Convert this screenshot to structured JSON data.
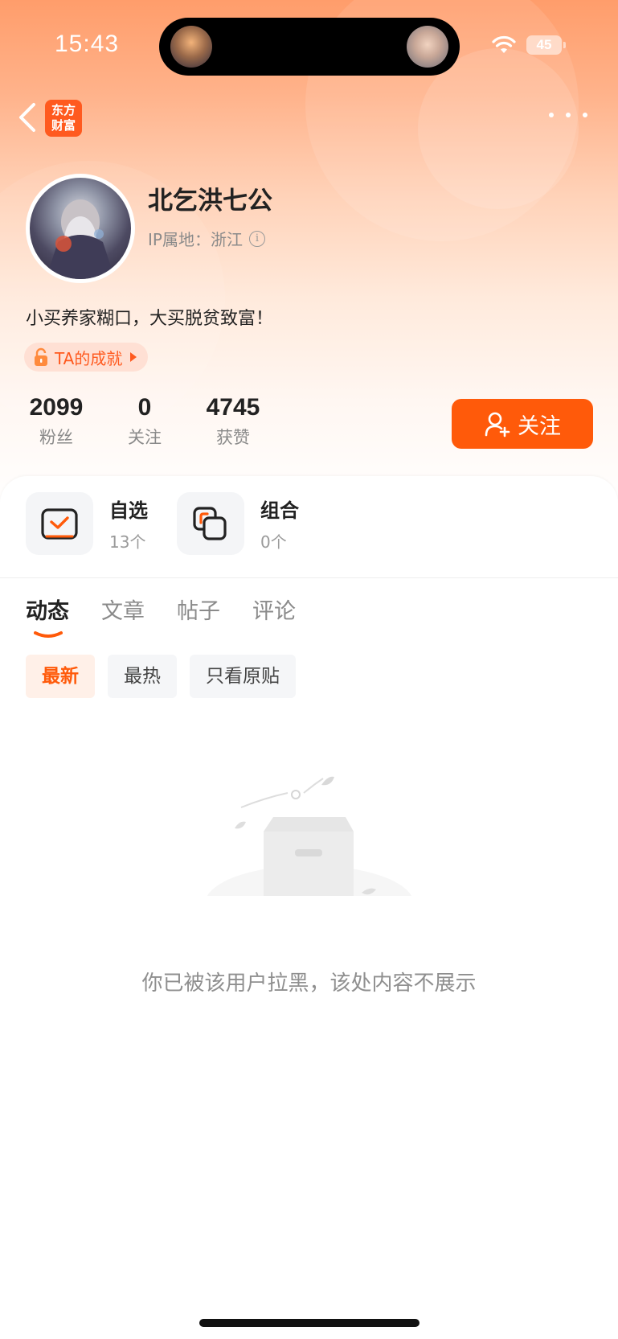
{
  "status_bar": {
    "time": "15:43",
    "battery": "45",
    "icons": [
      "wifi-icon",
      "battery-icon"
    ]
  },
  "nav": {
    "logo_line1": "东方",
    "logo_line2": "财富",
    "icons": [
      "back-arrow-icon",
      "more-dots-icon"
    ]
  },
  "profile": {
    "name": "北乞洪七公",
    "ip_label": "IP属地：",
    "ip_value": "浙江",
    "info_glyph": "i",
    "bio": "小买养家糊口，大买脱贫致富！",
    "achievement": "TA的成就"
  },
  "stats": [
    {
      "value": "2099",
      "label": "粉丝"
    },
    {
      "value": "0",
      "label": "关注"
    },
    {
      "value": "4745",
      "label": "获赞"
    }
  ],
  "follow_button": "关注",
  "tools": [
    {
      "title": "自选",
      "sub": "13个",
      "icon": "watchlist-check-icon"
    },
    {
      "title": "组合",
      "sub": "0个",
      "icon": "portfolio-icon"
    }
  ],
  "tabs": [
    "动态",
    "文章",
    "帖子",
    "评论"
  ],
  "active_tab": "动态",
  "filters": [
    "最新",
    "最热",
    "只看原贴"
  ],
  "active_filter": "最新",
  "empty_message": "你已被该用户拉黑，该处内容不展示",
  "colors": {
    "accent": "#ff5a0a",
    "header_gradient_top": "#ff9d6b",
    "muted_text": "#8a8a8a"
  }
}
